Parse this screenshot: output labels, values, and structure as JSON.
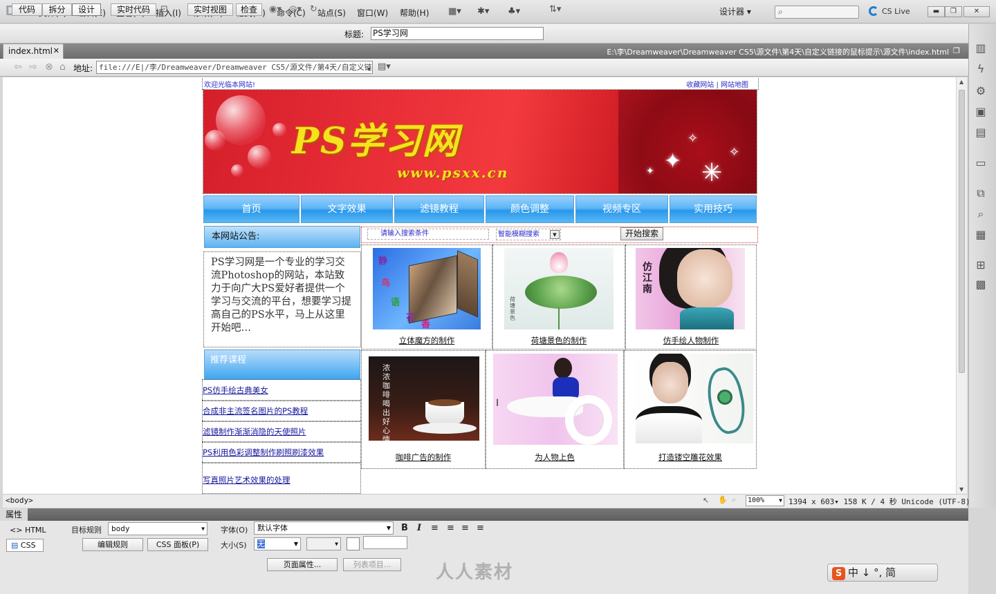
{
  "app": {
    "logo": "Dw"
  },
  "menu": [
    "文件(F)",
    "编辑(E)",
    "查看(V)",
    "插入(I)",
    "修改(M)",
    "格式(O)",
    "命令(C)",
    "站点(S)",
    "窗口(W)",
    "帮助(H)"
  ],
  "menubar_right": {
    "workspace": "设计器",
    "search_placeholder": "",
    "cs_live": "CS Live"
  },
  "doc_toolbar": {
    "code": "代码",
    "split": "拆分",
    "design": "设计",
    "live_code": "实时代码",
    "live_view": "实时视图",
    "inspect": "检查",
    "title_label": "标题:",
    "title_value": "PS学习网"
  },
  "tab": {
    "name": "index.html",
    "path": "E:\\李\\Dreamweaver\\Dreamweaver CS5\\源文件\\第4天\\自定义链接的鼠标提示\\源文件\\index.html"
  },
  "address": {
    "label": "地址:",
    "value": "file:///E|/李/Dreamweaver/Dreamweaver CS5/源文件/第4天/自定义链"
  },
  "page": {
    "welcome": "欢迎光临本网站!",
    "top_links": "收藏网站 | 网站地图",
    "logo": "PS学习网",
    "url": "www.psxx.cn",
    "nav": [
      "首页",
      "文字效果",
      "滤镜教程",
      "颜色调整",
      "视频专区",
      "实用技巧"
    ],
    "notice_title": "本网站公告:",
    "notice_text": "PS学习网是一个专业的学习交流Photoshop的网站，本站致力于向广大PS爱好者提供一个学习与交流的平台，想要学习提高自己的PS水平，马上从这里开始吧…",
    "rec_title": "推荐课程",
    "rec_items": [
      "PS仿手绘古典美女",
      "合成非主流签名图片的PS教程",
      "滤镜制作渐渐消隐的天使照片",
      "PS利用色彩调整制作刷照刷漆效果",
      "写真照片艺术效果的处理"
    ],
    "search_placeholder": "请输入搜索条件",
    "search_select": "智能模糊搜索",
    "search_button": "开始搜索",
    "captions": [
      "立体魔方的制作",
      "荷塘景色的制作",
      "仿手绘人物制作",
      "咖啡广告的制作",
      "为人物上色",
      "打造镂空雕花效果"
    ],
    "cube_texts": [
      "静",
      "鸟",
      "语",
      "花",
      "香"
    ],
    "poster_text": "浓浓咖啡喝出好心情",
    "lotus_text": "荷塘景色",
    "drawing_text": "仿江南"
  },
  "status": {
    "tag": "<body>",
    "zoom": "100%",
    "size": "1394 x 603",
    "info": "158 K / 4 秒  Unicode (UTF-8)"
  },
  "properties": {
    "tab": "属性",
    "html": "HTML",
    "css": "CSS",
    "target_rule_label": "目标规则",
    "target_rule": "body",
    "edit_rule": "编辑规则",
    "css_panel": "CSS 面板(P)",
    "font_label": "字体(O)",
    "font_value": "默认字体",
    "size_label": "大小(S)",
    "size_value": "无",
    "page_props": "页面属性...",
    "list_item": "列表项目..."
  },
  "watermark": "人人素材",
  "ime": "中 ↓ °, 简"
}
